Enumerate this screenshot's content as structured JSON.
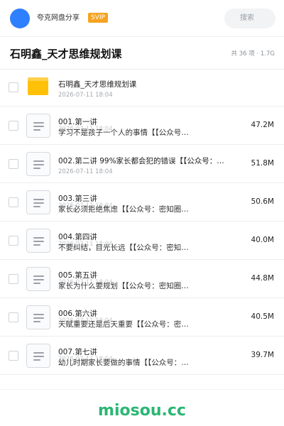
{
  "topbar": {
    "share_name": "夸克网盘分享",
    "badge": "SVIP",
    "search_placeholder": "搜索",
    "accent": "#2f80ff",
    "badge_color": "#f5a321"
  },
  "header": {
    "title": "石明鑫_天才思维规划课",
    "count": "共 36 项",
    "separator": " · ",
    "total_size": "1.7G"
  },
  "items": [
    {
      "type": "folder",
      "name": "石明鑫_天才思维规划课",
      "date": "2026-07-11 18:04",
      "size": ""
    },
    {
      "type": "file",
      "name": "001.第一讲",
      "desc": "学习不是孩子一个人的事情【【公众号…",
      "date": "2026-07-11 18:04",
      "size": "47.2M"
    },
    {
      "type": "file",
      "name": "002.第二讲 99%家长都会犯的错误【【公众号：…",
      "date": "2026-07-11 18:04",
      "size": "51.8M"
    },
    {
      "type": "file",
      "name": "003.第三讲",
      "desc": "家长必须拒绝焦虑【【公众号：密知圈…",
      "date": "2026-07-11 18:04",
      "size": "50.6M"
    },
    {
      "type": "file",
      "name": "004.第四讲",
      "desc": "不要纠结，目光长远【【公众号：密知…",
      "date": "2026-07-11 18:04",
      "size": "40.0M"
    },
    {
      "type": "file",
      "name": "005.第五讲",
      "desc": "家长为什么要规划【【公众号：密知圈…",
      "date": "2026-07-11 18:04",
      "size": "44.8M"
    },
    {
      "type": "file",
      "name": "006.第六讲",
      "desc": "天赋重要还是后天重要【【公众号：密…",
      "date": "2026-07-11 18:04",
      "size": "40.5M"
    },
    {
      "type": "file",
      "name": "007.第七讲",
      "desc": "幼儿时期家长要做的事情【【公众号：…",
      "date": "2026-07-11 18:04",
      "size": "39.7M"
    }
  ],
  "footer": {
    "watermark": "miosou.cc",
    "watermark_color": "#2bb673"
  }
}
